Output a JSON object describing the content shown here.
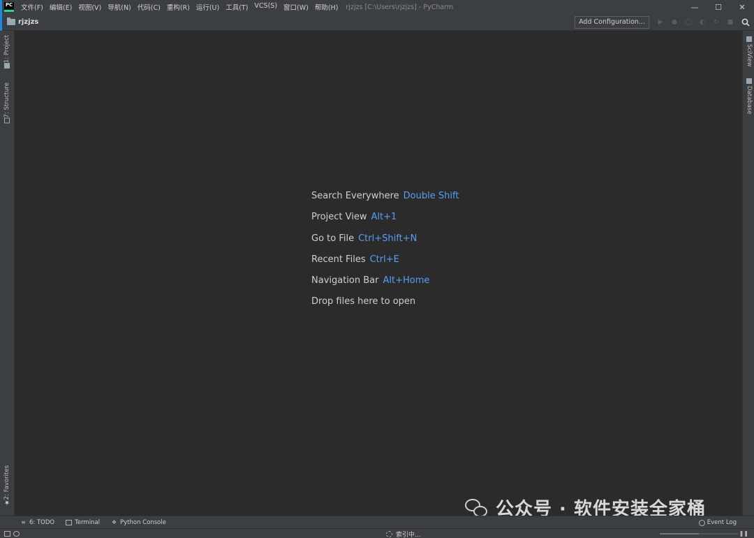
{
  "app": {
    "logo_text": "PC",
    "window_title": "rjzjzs [C:\\Users\\rjzjzs] - PyCharm"
  },
  "menu": [
    "文件(F)",
    "编辑(E)",
    "视图(V)",
    "导航(N)",
    "代码(C)",
    "重构(R)",
    "运行(U)",
    "工具(T)",
    "VCS(S)",
    "窗口(W)",
    "帮助(H)"
  ],
  "navbar": {
    "project": "rjzjzs",
    "add_configuration": "Add Configuration..."
  },
  "left_tabs": {
    "project": "1: Project",
    "structure": "7: Structure",
    "favorites": "2: Favorites"
  },
  "right_tabs": {
    "sciview": "SciView",
    "database": "Database"
  },
  "hints": [
    {
      "label": "Search Everywhere",
      "key": "Double Shift"
    },
    {
      "label": "Project View",
      "key": "Alt+1"
    },
    {
      "label": "Go to File",
      "key": "Ctrl+Shift+N"
    },
    {
      "label": "Recent Files",
      "key": "Ctrl+E"
    },
    {
      "label": "Navigation Bar",
      "key": "Alt+Home"
    },
    {
      "label": "Drop files here to open",
      "key": ""
    }
  ],
  "bottom_tabs": {
    "todo": "6: TODO",
    "terminal": "Terminal",
    "python_console": "Python Console",
    "event_log": "Event Log"
  },
  "status": {
    "indexing": "索引中...",
    "progress_fraction": 0.5
  },
  "watermark": "公众号 · 软件安装全家桶",
  "colors": {
    "background": "#2b2b2b",
    "panel": "#3c3f41",
    "shortcut": "#589df6",
    "accent": "#1e88e5"
  }
}
